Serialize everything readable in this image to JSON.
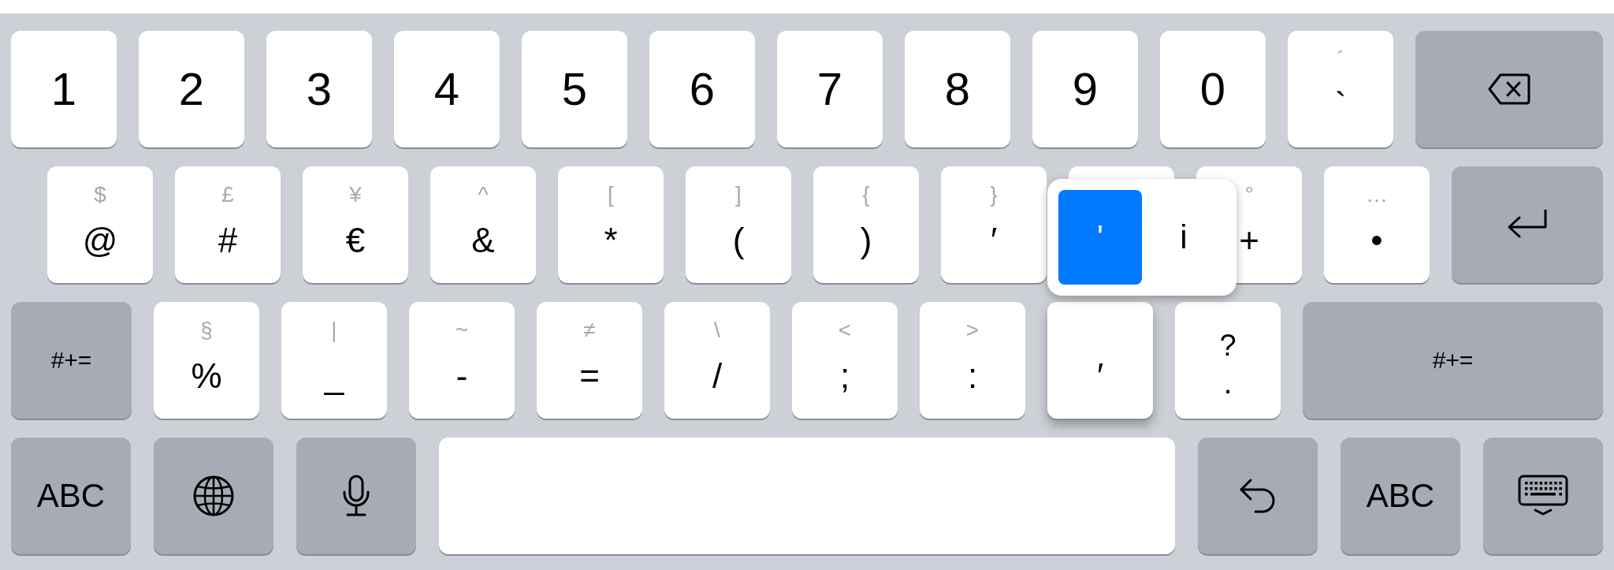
{
  "rows": [
    {
      "keys": [
        {
          "kind": "char",
          "label": "1",
          "pressed": false
        },
        {
          "kind": "char",
          "label": "2",
          "pressed": false
        },
        {
          "kind": "char",
          "label": "3",
          "pressed": false
        },
        {
          "kind": "char",
          "label": "4",
          "pressed": false
        },
        {
          "kind": "char",
          "label": "5",
          "pressed": false
        },
        {
          "kind": "char",
          "label": "6",
          "pressed": false
        },
        {
          "kind": "char",
          "label": "7",
          "pressed": false
        },
        {
          "kind": "char",
          "label": "8",
          "pressed": false
        },
        {
          "kind": "char",
          "label": "9",
          "pressed": false
        },
        {
          "kind": "char",
          "label": "0",
          "pressed": false
        },
        {
          "kind": "char",
          "label": "`",
          "secondary": "´",
          "pressed": false
        },
        {
          "kind": "delete",
          "pressed": false
        }
      ]
    },
    {
      "keys": [
        {
          "kind": "char",
          "label": "@",
          "secondary": "$",
          "pressed": false
        },
        {
          "kind": "char",
          "label": "#",
          "secondary": "£",
          "pressed": false
        },
        {
          "kind": "char",
          "label": "€",
          "secondary": "¥",
          "pressed": false
        },
        {
          "kind": "char",
          "label": "&",
          "secondary": "^",
          "pressed": false
        },
        {
          "kind": "char",
          "label": "*",
          "secondary": "[",
          "pressed": false
        },
        {
          "kind": "char",
          "label": "(",
          "secondary": "]",
          "pressed": false
        },
        {
          "kind": "char",
          "label": ")",
          "secondary": "{",
          "pressed": false
        },
        {
          "kind": "char",
          "label": "′",
          "secondary": "}",
          "pressed": false
        },
        {
          "kind": "char",
          "pressed": false
        },
        {
          "kind": "char",
          "label": "+",
          "secondary": "°",
          "pressed": false
        },
        {
          "kind": "char",
          "label": "•",
          "secondary": "…",
          "pressed": false
        },
        {
          "kind": "return",
          "pressed": false
        }
      ]
    },
    {
      "keys": [
        {
          "kind": "function",
          "label": "#+=",
          "pressed": false
        },
        {
          "kind": "char",
          "label": "%",
          "secondary": "§",
          "pressed": false
        },
        {
          "kind": "char",
          "label": "_",
          "secondary": "|",
          "pressed": false
        },
        {
          "kind": "char",
          "label": "-",
          "secondary": "~",
          "pressed": false
        },
        {
          "kind": "char",
          "label": "=",
          "secondary": "≠",
          "pressed": false
        },
        {
          "kind": "char",
          "label": "/",
          "secondary": "\\",
          "pressed": false
        },
        {
          "kind": "char",
          "label": ";",
          "secondary": "<",
          "pressed": false
        },
        {
          "kind": "char",
          "label": ":",
          "secondary": ">",
          "pressed": false
        },
        {
          "kind": "char",
          "label": "′",
          "pressed": true
        },
        {
          "kind": "stacked",
          "label": ".",
          "secondary": "?",
          "pressed": false
        },
        {
          "kind": "function",
          "label": "#+=",
          "pressed": false
        }
      ]
    },
    {
      "keys": [
        {
          "kind": "function",
          "label": "ABC",
          "pressed": false
        },
        {
          "kind": "globe",
          "pressed": false
        },
        {
          "kind": "dictation",
          "pressed": false
        },
        {
          "kind": "space",
          "pressed": false
        },
        {
          "kind": "undo",
          "pressed": false
        },
        {
          "kind": "function",
          "label": "ABC",
          "pressed": false
        },
        {
          "kind": "dismiss",
          "pressed": false
        }
      ]
    }
  ],
  "popup": {
    "options": [
      {
        "label": "'",
        "selected": true
      },
      {
        "label": "i",
        "selected": false
      }
    ]
  }
}
